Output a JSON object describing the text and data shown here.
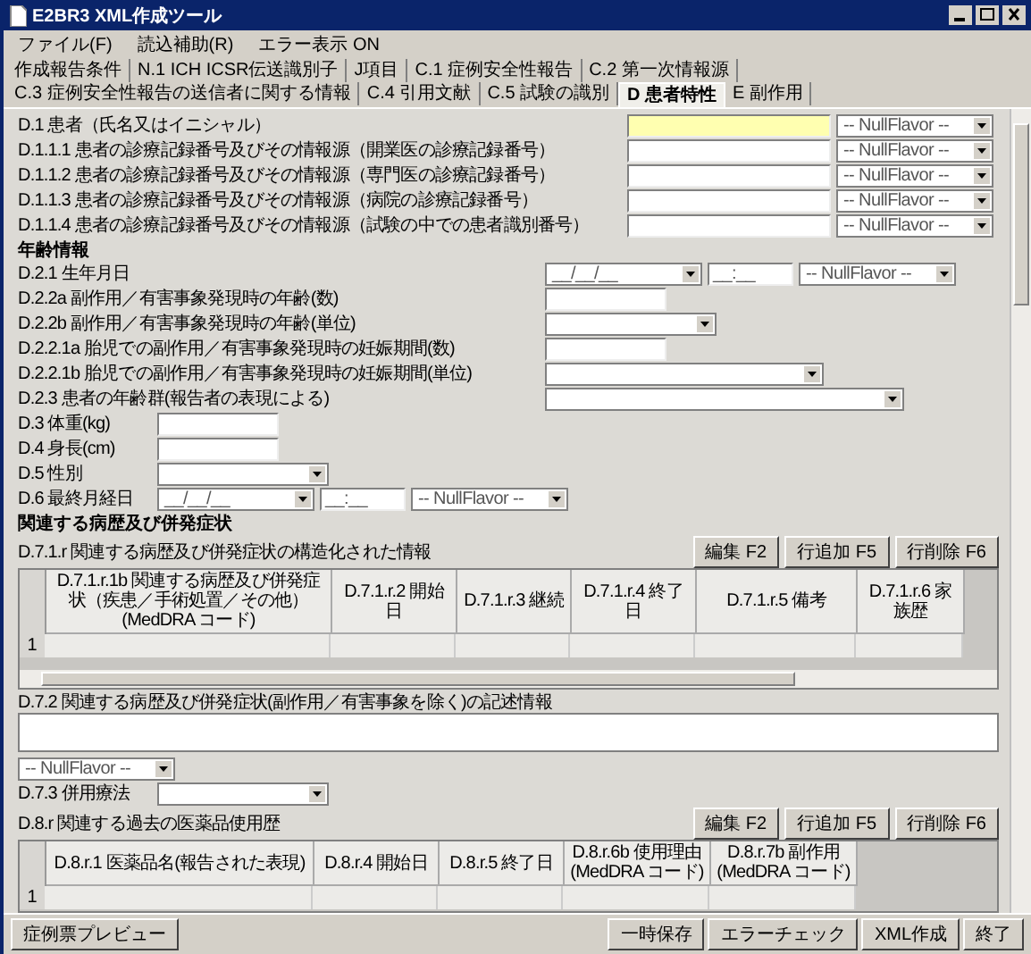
{
  "window": {
    "title": "E2BR3 XML作成ツール"
  },
  "menu": [
    {
      "label": "ファイル(F)"
    },
    {
      "label": "読込補助(R)"
    },
    {
      "label": "エラー表示 ON"
    }
  ],
  "tabs": [
    {
      "label": "作成報告条件",
      "selected": false
    },
    {
      "label": "N.1 ICH ICSR伝送識別子",
      "selected": false
    },
    {
      "label": "J項目",
      "selected": false
    },
    {
      "label": "C.1 症例安全性報告",
      "selected": false
    },
    {
      "label": "C.2 第一次情報源",
      "selected": false
    },
    {
      "label": "C.3 症例安全性報告の送信者に関する情報",
      "selected": false
    },
    {
      "label": "C.4 引用文献",
      "selected": false
    },
    {
      "label": "C.5 試験の識別",
      "selected": false
    },
    {
      "label": "D 患者特性",
      "selected": true
    },
    {
      "label": "E 副作用",
      "selected": false
    }
  ],
  "patient_fields": [
    {
      "label": "D.1 患者（氏名又はイニシャル）",
      "highlighted": true,
      "null_flavor": "-- NullFlavor --"
    },
    {
      "label": "D.1.1.1 患者の診療記録番号及びその情報源（開業医の診療記録番号）",
      "highlighted": false,
      "null_flavor": "-- NullFlavor --"
    },
    {
      "label": "D.1.1.2 患者の診療記録番号及びその情報源（専門医の診療記録番号）",
      "highlighted": false,
      "null_flavor": "-- NullFlavor --"
    },
    {
      "label": "D.1.1.3 患者の診療記録番号及びその情報源（病院の診療記録番号）",
      "highlighted": false,
      "null_flavor": "-- NullFlavor --"
    },
    {
      "label": "D.1.1.4 患者の診療記録番号及びその情報源（試験の中での患者識別番号）",
      "highlighted": false,
      "null_flavor": "-- NullFlavor --"
    }
  ],
  "age_section": {
    "title": "年齢情報",
    "fields": [
      {
        "label": "D.2.1 生年月日",
        "kind": "date",
        "date": "__/__/__",
        "time": "__:__",
        "null_flavor": "-- NullFlavor --"
      },
      {
        "label": "D.2.2a 副作用／有害事象発現時の年齢(数)",
        "kind": "text"
      },
      {
        "label": "D.2.2b 副作用／有害事象発現時の年齢(単位)",
        "kind": "select"
      },
      {
        "label": "D.2.2.1a 胎児での副作用／有害事象発現時の妊娠期間(数)",
        "kind": "text"
      },
      {
        "label": "D.2.2.1b 胎児での副作用／有害事象発現時の妊娠期間(単位)",
        "kind": "select-wide"
      },
      {
        "label": "D.2.3 患者の年齢群(報告者の表現による)",
        "kind": "select-wider"
      }
    ]
  },
  "body_fields": [
    {
      "label": "D.3 体重(kg)",
      "kind": "text"
    },
    {
      "label": "D.4 身長(cm)",
      "kind": "text"
    },
    {
      "label": "D.5 性別",
      "kind": "select"
    },
    {
      "label": "D.6 最終月経日",
      "kind": "date",
      "date": "__/__/__",
      "time": "__:__",
      "null_flavor": "-- NullFlavor --"
    }
  ],
  "history_section": {
    "title": "関連する病歴及び併発症状",
    "structured": {
      "label": "D.7.1.r 関連する病歴及び併発症状の構造化された情報",
      "buttons": [
        "編集 F2",
        "行追加 F5",
        "行削除 F6"
      ],
      "columns": [
        "D.7.1.r.1b 関連する病歴及び併発症状（疾患／手術処置／その他）(MedDRA コード)",
        "D.7.1.r.2 開始日",
        "D.7.1.r.3 継続",
        "D.7.1.r.4 終了日",
        "D.7.1.r.5 備考",
        "D.7.1.r.6 家族歴"
      ],
      "rows": [
        {
          "number": "1"
        }
      ]
    },
    "narrative": {
      "label": "D.7.2 関連する病歴及び併発症状(副作用／有害事象を除く)の記述情報",
      "null_flavor": "-- NullFlavor --"
    },
    "concomitant": {
      "label": "D.7.3 併用療法"
    }
  },
  "past_drugs": {
    "label": "D.8.r 関連する過去の医薬品使用歴",
    "buttons": [
      "編集 F2",
      "行追加 F5",
      "行削除 F6"
    ],
    "columns": [
      "D.8.r.1 医薬品名(報告された表現)",
      "D.8.r.4 開始日",
      "D.8.r.5 終了日",
      "D.8.r.6b 使用理由 (MedDRA コード)",
      "D.8.r.7b 副作用 (MedDRA コード)"
    ],
    "rows": [
      {
        "number": "1"
      }
    ]
  },
  "footer": {
    "left": "症例票プレビュー",
    "right": [
      "一時保存",
      "エラーチェック",
      "XML作成",
      "終了"
    ]
  }
}
